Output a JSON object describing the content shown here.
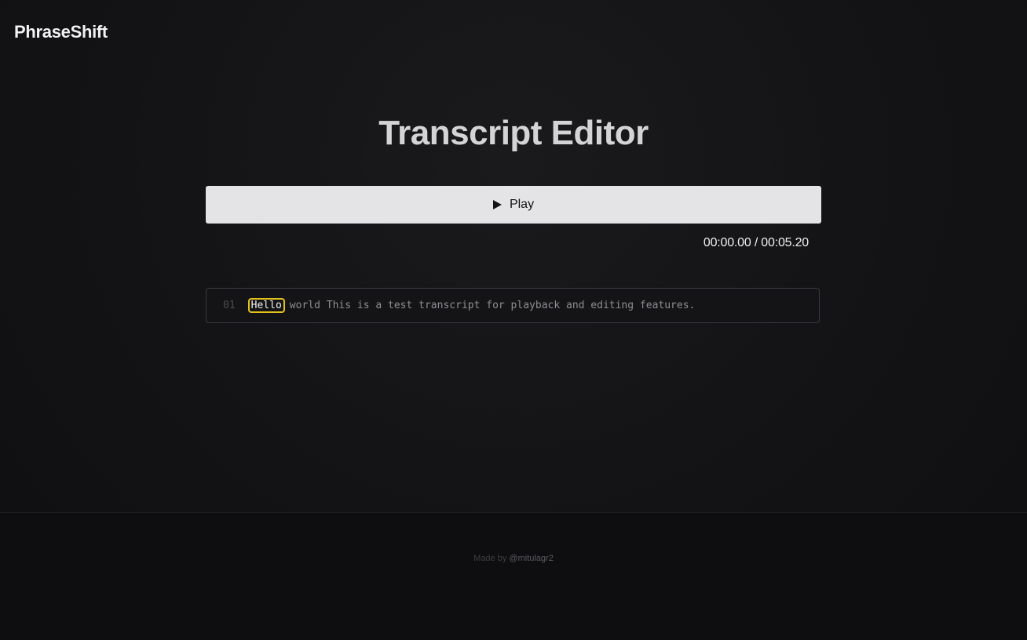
{
  "header": {
    "brand": "PhraseShift"
  },
  "main": {
    "title": "Transcript Editor",
    "play_label": "Play",
    "time_readout": "00:00.00 / 00:05.20"
  },
  "transcript": {
    "line_number": "01",
    "active_word": "Hello",
    "rest_text": "world This is a test transcript for playback and editing features."
  },
  "footer": {
    "made_by_prefix": "Made by",
    "author": "@mitulagr2"
  },
  "colors": {
    "highlight": "#e2c21c",
    "button_bg": "#e4e4e6",
    "background": "#111113"
  },
  "icons": {
    "play": "play-icon"
  }
}
